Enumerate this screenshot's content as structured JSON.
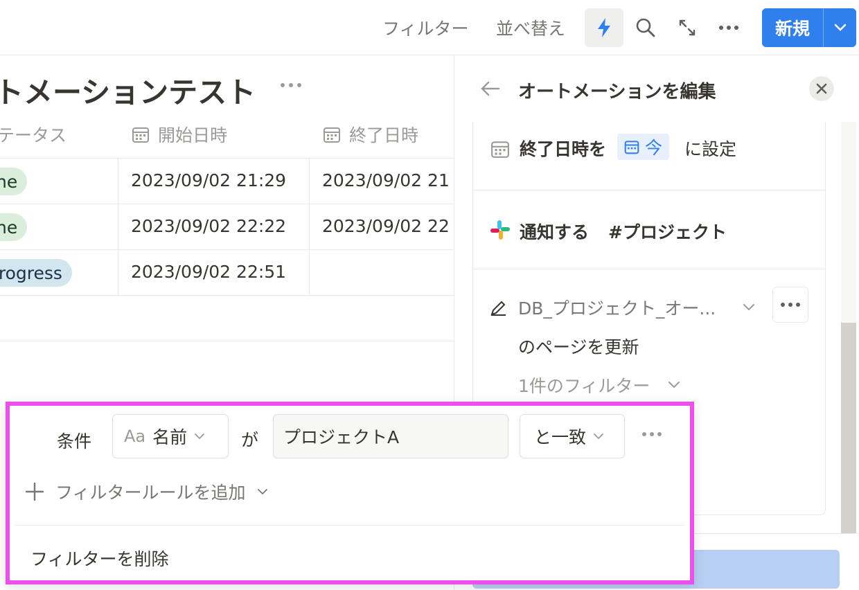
{
  "toolbar": {
    "filter_label": "フィルター",
    "sort_label": "並べ替え",
    "new_label": "新規",
    "accent_color": "#2f80ed"
  },
  "database": {
    "title": "トメーションテスト",
    "columns": [
      {
        "label": "テータス",
        "icon": "none"
      },
      {
        "label": "開始日時",
        "icon": "calendar-icon"
      },
      {
        "label": "終了日時",
        "icon": "calendar-icon"
      }
    ],
    "rows": [
      {
        "status": "ne",
        "status_color": "green",
        "start": "2023/09/02 21:29",
        "end": "2023/09/02 21"
      },
      {
        "status": "ne",
        "status_color": "green",
        "start": "2023/09/02 22:22",
        "end": "2023/09/02 22"
      },
      {
        "status": "progress",
        "status_color": "blue",
        "start": "2023/09/02 22:51",
        "end": ""
      }
    ]
  },
  "panel": {
    "title": "オートメーションを編集",
    "action_set_prefix": "終了日時を",
    "action_set_chip": "今",
    "action_set_suffix": "に設定",
    "action_notify": "通知する",
    "action_notify_channel": "#プロジェクト",
    "action_update_db": "DB_プロジェクト_オー...",
    "action_update_label": "のページを更新",
    "filter_count": "1件のフィルター"
  },
  "filter_popover": {
    "condition_label": "条件",
    "property_prefix": "Aa",
    "property": "名前",
    "connector": "が",
    "value": "プロジェクトA",
    "operator": "と一致",
    "add_rule": "フィルタールールを追加",
    "delete": "フィルターを削除",
    "highlight_color": "#ed4fed"
  }
}
